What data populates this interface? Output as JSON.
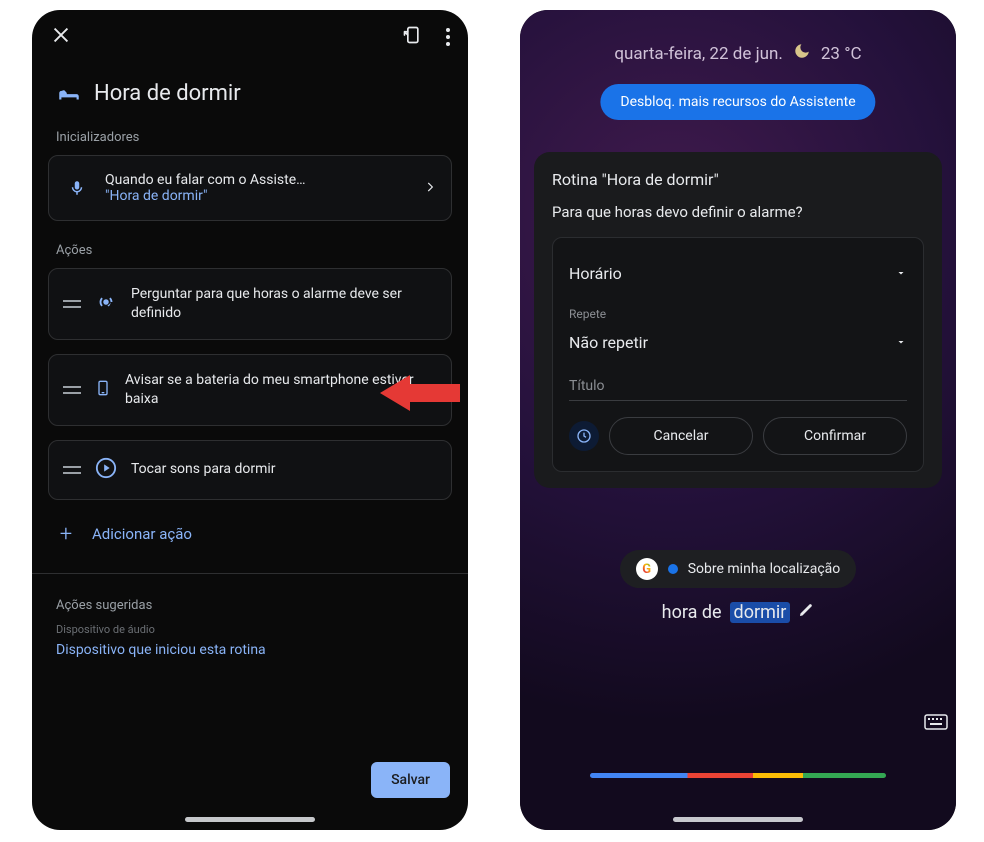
{
  "left": {
    "title": "Hora de dormir",
    "sections": {
      "starters_label": "Inicializadores",
      "starter": {
        "line1": "Quando eu falar com o Assiste…",
        "line2": "\"Hora de dormir\""
      },
      "actions_label": "Ações",
      "actions": [
        {
          "icon": "broadcast",
          "text": "Perguntar para que horas o alarme deve ser definido"
        },
        {
          "icon": "phone",
          "text": "Avisar se a bateria do meu smartphone estiver baixa"
        },
        {
          "icon": "play",
          "text": "Tocar sons para dormir"
        }
      ],
      "add_action_label": "Adicionar ação",
      "suggested_label": "Ações sugeridas",
      "device_label": "Dispositivo de áudio",
      "device_link": "Dispositivo que iniciou esta rotina",
      "save": "Salvar"
    }
  },
  "right": {
    "date": "quarta-feira, 22 de jun.",
    "temp": "23 °C",
    "unlock_banner": "Desbloq. mais recursos do Assistente",
    "panel": {
      "title": "Rotina \"Hora de dormir\"",
      "question": "Para que horas devo definir o alarme?",
      "field_time": "Horário",
      "repeat_label": "Repete",
      "repeat_value": "Não repetir",
      "title_placeholder": "Título",
      "cancel": "Cancelar",
      "confirm": "Confirmar"
    },
    "chip": "Sobre minha localização",
    "transcript_pre": "hora de ",
    "transcript_hl": "dormir"
  }
}
